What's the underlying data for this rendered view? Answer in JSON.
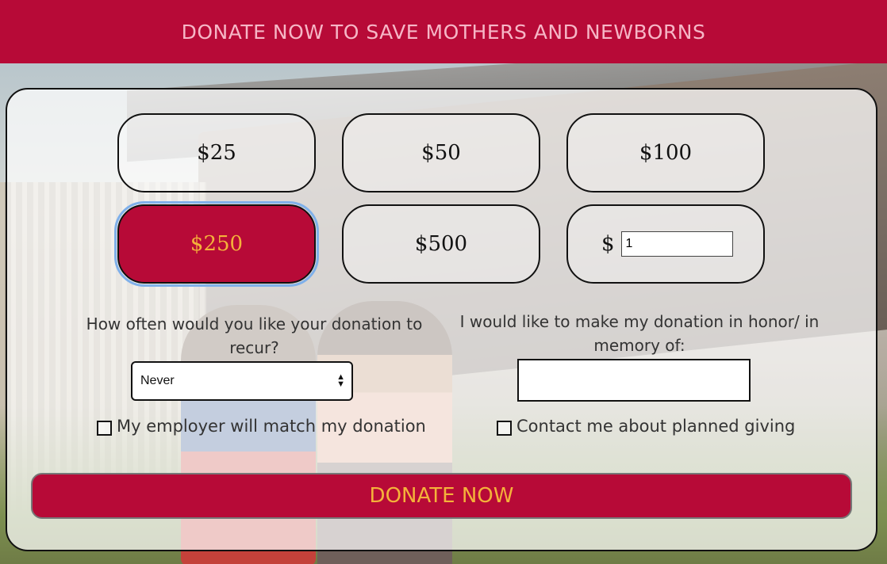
{
  "header": {
    "title": "DONATE NOW TO SAVE MOTHERS AND NEWBORNS"
  },
  "amounts": [
    {
      "label": "$25"
    },
    {
      "label": "$50"
    },
    {
      "label": "$100"
    },
    {
      "label": "$250",
      "selected": true
    },
    {
      "label": "$500"
    }
  ],
  "custom_amount": {
    "currency": "$",
    "value": "1"
  },
  "recurrence": {
    "label": "How often would you like your donation to recur?",
    "selected": "Never"
  },
  "honor": {
    "label": "I would like to make my donation in honor/ in memory of:",
    "value": ""
  },
  "checkboxes": {
    "employer_match": "My employer will match my donation",
    "planned_giving": "Contact me about planned giving"
  },
  "donate_button": {
    "label": "DONATE NOW"
  },
  "colors": {
    "brand": "#b70a37",
    "header_text": "#f6b6c6",
    "accent": "#f4b23a"
  }
}
